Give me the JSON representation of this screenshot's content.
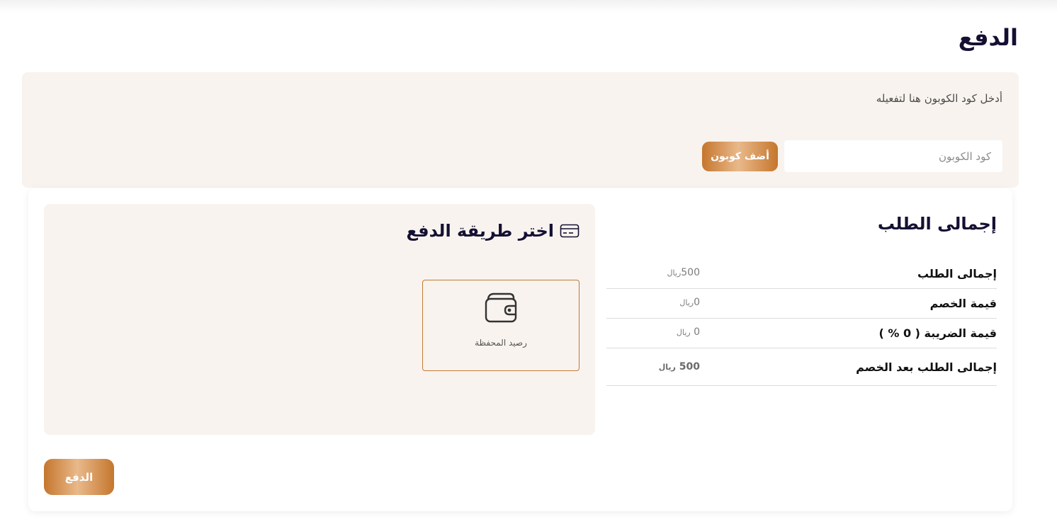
{
  "page": {
    "title": "الدفع"
  },
  "coupon": {
    "hint": "أدخل كود الكوبون هنا لتفعيله",
    "placeholder": "كود الكوبون",
    "button_label": "أضف كوبون"
  },
  "summary": {
    "title": "إجمالى الطلب",
    "currency": "ريال",
    "rows": [
      {
        "label": "إجمالى الطلب",
        "value": "500"
      },
      {
        "label": "قيمة الخصم",
        "value": "0"
      },
      {
        "label": "قيمة الضريبة ( 0 % )",
        "value": "0"
      }
    ],
    "total": {
      "label": "إجمالى الطلب بعد الخصم",
      "value": "500"
    }
  },
  "payment_methods": {
    "title": "اختر طريقة الدفع",
    "title_icon": "credit-card-icon",
    "options": [
      {
        "label": "رصيد المحفظة",
        "icon": "wallet-icon"
      }
    ]
  },
  "pay_button": {
    "label": "الدفع"
  },
  "colors": {
    "accent": "#c5762d",
    "panel_bg": "#f8f3ee",
    "heading": "#141033"
  }
}
